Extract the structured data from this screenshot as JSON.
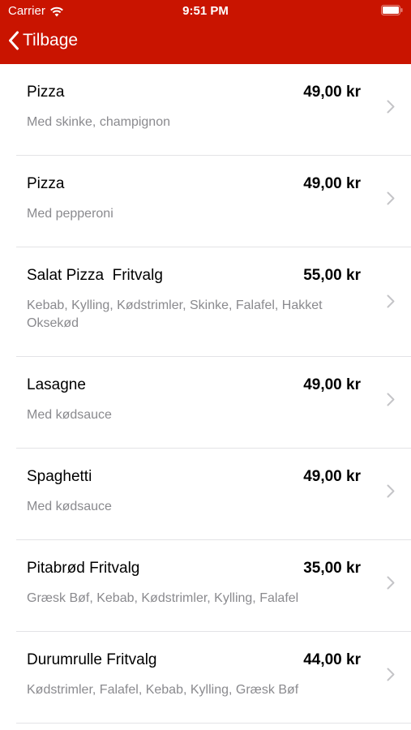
{
  "status_bar": {
    "carrier": "Carrier",
    "time": "9:51 PM"
  },
  "nav": {
    "back_label": "Tilbage"
  },
  "items": [
    {
      "name": "Pizza",
      "price": "49,00 kr",
      "description": "Med skinke, champignon"
    },
    {
      "name": "Pizza",
      "price": "49,00 kr",
      "description": "Med pepperoni"
    },
    {
      "name": "Salat Pizza  Fritvalg",
      "price": "55,00 kr",
      "description": "Kebab, Kylling, Kødstrimler, Skinke, Falafel, Hakket Oksekød"
    },
    {
      "name": "Lasagne",
      "price": "49,00 kr",
      "description": "Med kødsauce"
    },
    {
      "name": "Spaghetti",
      "price": "49,00 kr",
      "description": "Med kødsauce"
    },
    {
      "name": "Pitabrød Fritvalg",
      "price": "35,00 kr",
      "description": "Græsk Bøf, Kebab, Kødstrimler, Kylling, Falafel"
    },
    {
      "name": "Durumrulle Fritvalg",
      "price": "44,00 kr",
      "description": "Kødstrimler, Falafel, Kebab, Kylling, Græsk Bøf"
    }
  ],
  "colors": {
    "header": "#c91400",
    "description": "#8a8a8e",
    "chevron": "#c4c4c7"
  }
}
